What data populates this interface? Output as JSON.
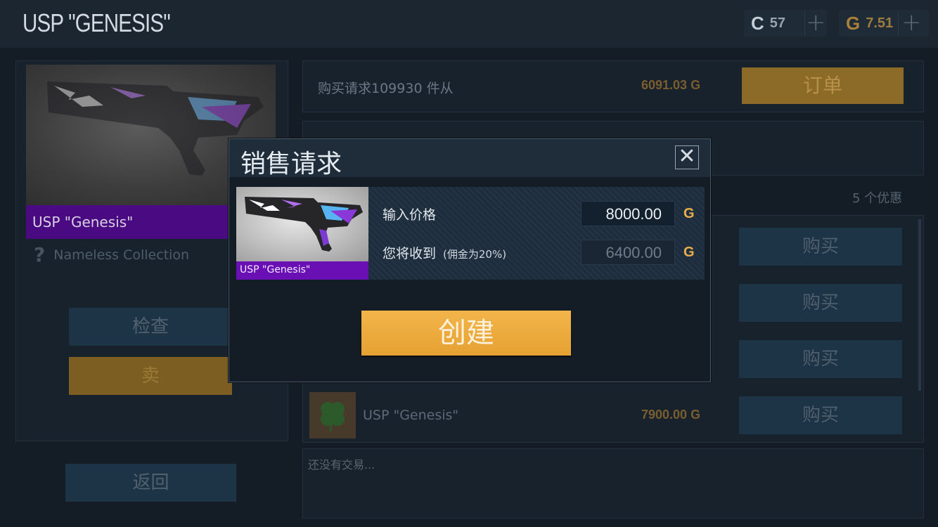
{
  "header": {
    "title": "USP \"GENESIS\"",
    "currency1": {
      "icon": "coin-c-icon",
      "value": "57",
      "color": "#c3ccd4"
    },
    "currency2": {
      "icon": "gold-g-icon",
      "value": "7.51",
      "color": "#e0a747"
    },
    "plus": "+"
  },
  "item": {
    "name": "USP \"Genesis\"",
    "collection_icon": "?",
    "collection": "Nameless Collection",
    "rarity_color": "#4a0a82"
  },
  "left_buttons": {
    "inspect": "检查",
    "sell": "卖",
    "back": "返回"
  },
  "buy_request": {
    "text": "购买请求109930 件从",
    "price": "6091.03 G",
    "order_button": "订单"
  },
  "offers": {
    "count": "5 个优惠",
    "buy_label": "购买",
    "visible_offer": {
      "name": "USP \"Genesis\"",
      "price": "7900.00 G"
    }
  },
  "trades": {
    "empty": "还没有交易..."
  },
  "dialog": {
    "title": "销售请求",
    "close": "✕",
    "item_name": "USP \"Genesis\"",
    "price_label": "输入价格",
    "price_value": "8000.00",
    "receive_label": "您将收到",
    "commission": "(佣金为20%)",
    "receive_value": "6400.00",
    "currency_symbol": "G",
    "create_button": "创建"
  },
  "colors": {
    "accent_gold": "#e6a132",
    "rarity_purple": "#6a0fb3",
    "dialog_bg": "#141d26"
  }
}
